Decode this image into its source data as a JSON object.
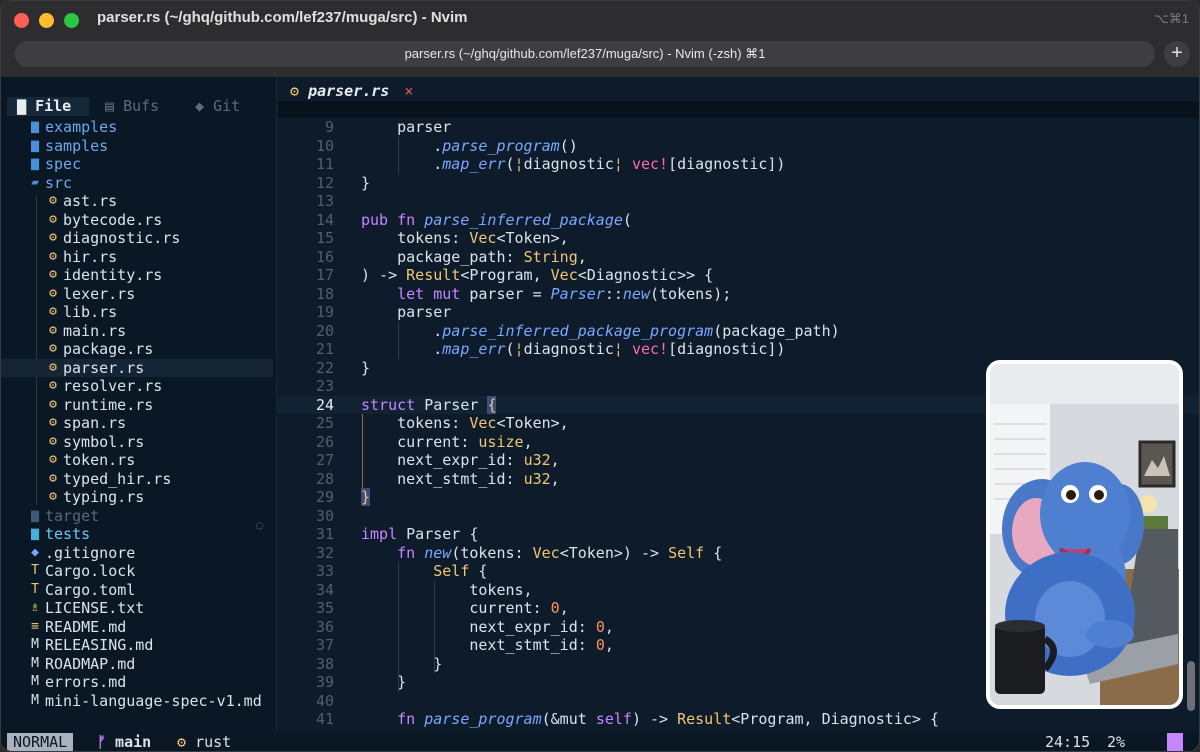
{
  "window": {
    "title": "parser.rs (~/ghq/github.com/lef237/muga/src) - Nvim",
    "shortcut": "⌥⌘1",
    "tab_title": "parser.rs (~/ghq/github.com/lef237/muga/src) - Nvim (-zsh) ⌘1",
    "new_tab_label": "+"
  },
  "sidebar": {
    "tabs": [
      {
        "icon": "▇",
        "label": "File"
      },
      {
        "icon": "▤",
        "label": "Bufs"
      },
      {
        "icon": "◆",
        "label": "Git"
      }
    ],
    "tree": [
      {
        "name": "examples",
        "icon": "▆",
        "kind": "folder",
        "icon_name": "folder-icon",
        "depth": 0
      },
      {
        "name": "samples",
        "icon": "▆",
        "kind": "folder",
        "icon_name": "folder-icon",
        "depth": 0
      },
      {
        "name": "spec",
        "icon": "▆",
        "kind": "folder",
        "icon_name": "folder-icon",
        "depth": 0
      },
      {
        "name": "src",
        "icon": "▰",
        "kind": "folder-open",
        "icon_name": "folder-open-icon",
        "depth": 0
      },
      {
        "name": "ast.rs",
        "icon": "⚙",
        "kind": "rust",
        "icon_name": "rust-file-icon",
        "depth": 1
      },
      {
        "name": "bytecode.rs",
        "icon": "⚙",
        "kind": "rust",
        "icon_name": "rust-file-icon",
        "depth": 1
      },
      {
        "name": "diagnostic.rs",
        "icon": "⚙",
        "kind": "rust",
        "icon_name": "rust-file-icon",
        "depth": 1
      },
      {
        "name": "hir.rs",
        "icon": "⚙",
        "kind": "rust",
        "icon_name": "rust-file-icon",
        "depth": 1
      },
      {
        "name": "identity.rs",
        "icon": "⚙",
        "kind": "rust",
        "icon_name": "rust-file-icon",
        "depth": 1
      },
      {
        "name": "lexer.rs",
        "icon": "⚙",
        "kind": "rust",
        "icon_name": "rust-file-icon",
        "depth": 1
      },
      {
        "name": "lib.rs",
        "icon": "⚙",
        "kind": "rust",
        "icon_name": "rust-file-icon",
        "depth": 1
      },
      {
        "name": "main.rs",
        "icon": "⚙",
        "kind": "rust",
        "icon_name": "rust-file-icon",
        "depth": 1
      },
      {
        "name": "package.rs",
        "icon": "⚙",
        "kind": "rust",
        "icon_name": "rust-file-icon",
        "depth": 1
      },
      {
        "name": "parser.rs",
        "icon": "⚙",
        "kind": "rust",
        "icon_name": "rust-file-icon",
        "depth": 1,
        "selected": true
      },
      {
        "name": "resolver.rs",
        "icon": "⚙",
        "kind": "rust",
        "icon_name": "rust-file-icon",
        "depth": 1
      },
      {
        "name": "runtime.rs",
        "icon": "⚙",
        "kind": "rust",
        "icon_name": "rust-file-icon",
        "depth": 1
      },
      {
        "name": "span.rs",
        "icon": "⚙",
        "kind": "rust",
        "icon_name": "rust-file-icon",
        "depth": 1
      },
      {
        "name": "symbol.rs",
        "icon": "⚙",
        "kind": "rust",
        "icon_name": "rust-file-icon",
        "depth": 1
      },
      {
        "name": "token.rs",
        "icon": "⚙",
        "kind": "rust",
        "icon_name": "rust-file-icon",
        "depth": 1
      },
      {
        "name": "typed_hir.rs",
        "icon": "⚙",
        "kind": "rust",
        "icon_name": "rust-file-icon",
        "depth": 1
      },
      {
        "name": "typing.rs",
        "icon": "⚙",
        "kind": "rust",
        "icon_name": "rust-file-icon",
        "depth": 1
      },
      {
        "name": "target",
        "icon": "▆",
        "kind": "folder-dim",
        "icon_name": "folder-icon",
        "depth": 0
      },
      {
        "name": "tests",
        "icon": "▆",
        "kind": "folder-test",
        "icon_name": "test-folder-icon",
        "depth": 0
      },
      {
        "name": ".gitignore",
        "icon": "◆",
        "kind": "git",
        "icon_name": "git-icon",
        "depth": 0
      },
      {
        "name": "Cargo.lock",
        "icon": "T",
        "kind": "toml",
        "icon_name": "toml-icon",
        "depth": 0
      },
      {
        "name": "Cargo.toml",
        "icon": "T",
        "kind": "toml",
        "icon_name": "toml-icon",
        "depth": 0
      },
      {
        "name": "LICENSE.txt",
        "icon": "♗",
        "kind": "license",
        "icon_name": "license-icon",
        "depth": 0
      },
      {
        "name": "README.md",
        "icon": "≡",
        "kind": "readme",
        "icon_name": "readme-icon",
        "depth": 0
      },
      {
        "name": "RELEASING.md",
        "icon": "M",
        "kind": "md",
        "icon_name": "markdown-icon",
        "depth": 0
      },
      {
        "name": "ROADMAP.md",
        "icon": "M",
        "kind": "md",
        "icon_name": "markdown-icon",
        "depth": 0
      },
      {
        "name": "errors.md",
        "icon": "M",
        "kind": "md",
        "icon_name": "markdown-icon",
        "depth": 0
      },
      {
        "name": "mini-language-spec-v1.md",
        "icon": "M",
        "kind": "md",
        "icon_name": "markdown-icon",
        "depth": 0
      }
    ],
    "spinner_icon": "◌"
  },
  "editor": {
    "tab": {
      "icon": "⚙",
      "filename": "parser.rs",
      "close": "×"
    },
    "current_line": 24,
    "lines": [
      {
        "n": "9",
        "t": [
          [
            "    parser",
            ""
          ]
        ]
      },
      {
        "n": "10",
        "t": [
          [
            "        .",
            ""
          ],
          [
            "parse_program",
            "fn"
          ],
          [
            "()",
            ""
          ]
        ]
      },
      {
        "n": "11",
        "t": [
          [
            "        .",
            ""
          ],
          [
            "map_err",
            "fn"
          ],
          [
            "(",
            ""
          ],
          [
            "¦",
            "pipe"
          ],
          [
            "diagnostic",
            ""
          ],
          [
            "¦",
            "pipe"
          ],
          [
            " ",
            ""
          ],
          [
            "vec!",
            "mac"
          ],
          [
            "[diagnostic])",
            ""
          ]
        ]
      },
      {
        "n": "12",
        "t": [
          [
            "}",
            ""
          ]
        ]
      },
      {
        "n": "13",
        "t": []
      },
      {
        "n": "14",
        "t": [
          [
            "pub fn ",
            "kw"
          ],
          [
            "parse_inferred_package",
            "fn"
          ],
          [
            "(",
            ""
          ]
        ]
      },
      {
        "n": "15",
        "t": [
          [
            "    tokens: ",
            ""
          ],
          [
            "Vec",
            "ty"
          ],
          [
            "<Token>,",
            ""
          ]
        ]
      },
      {
        "n": "16",
        "t": [
          [
            "    package_path: ",
            ""
          ],
          [
            "String",
            "ty"
          ],
          [
            ",",
            ""
          ]
        ]
      },
      {
        "n": "17",
        "t": [
          [
            ") -> ",
            ""
          ],
          [
            "Result",
            "ty"
          ],
          [
            "<Program, ",
            ""
          ],
          [
            "Vec",
            "ty"
          ],
          [
            "<Diagnostic>> {",
            ""
          ]
        ]
      },
      {
        "n": "18",
        "t": [
          [
            "    let mut ",
            "kw"
          ],
          [
            "parser = ",
            ""
          ],
          [
            "Parser",
            "fn"
          ],
          [
            "::",
            ""
          ],
          [
            "new",
            "fn"
          ],
          [
            "(tokens);",
            ""
          ]
        ]
      },
      {
        "n": "19",
        "t": [
          [
            "    parser",
            ""
          ]
        ]
      },
      {
        "n": "20",
        "t": [
          [
            "        .",
            ""
          ],
          [
            "parse_inferred_package_program",
            "fn"
          ],
          [
            "(package_path)",
            ""
          ]
        ]
      },
      {
        "n": "21",
        "t": [
          [
            "        .",
            ""
          ],
          [
            "map_err",
            "fn"
          ],
          [
            "(",
            ""
          ],
          [
            "¦",
            "pipe"
          ],
          [
            "diagnostic",
            ""
          ],
          [
            "¦",
            "pipe"
          ],
          [
            " ",
            ""
          ],
          [
            "vec!",
            "mac"
          ],
          [
            "[diagnostic])",
            ""
          ]
        ]
      },
      {
        "n": "22",
        "t": [
          [
            "}",
            ""
          ]
        ]
      },
      {
        "n": "23",
        "t": []
      },
      {
        "n": "24",
        "t": [
          [
            "struct ",
            "kw"
          ],
          [
            "Parser ",
            ""
          ],
          [
            "{",
            "brace"
          ]
        ]
      },
      {
        "n": "25",
        "t": [
          [
            "    tokens: ",
            ""
          ],
          [
            "Vec",
            "ty"
          ],
          [
            "<Token>,",
            ""
          ]
        ]
      },
      {
        "n": "26",
        "t": [
          [
            "    current: ",
            ""
          ],
          [
            "usize",
            "ty"
          ],
          [
            ",",
            ""
          ]
        ]
      },
      {
        "n": "27",
        "t": [
          [
            "    next_expr_id: ",
            ""
          ],
          [
            "u32",
            "ty"
          ],
          [
            ",",
            ""
          ]
        ]
      },
      {
        "n": "28",
        "t": [
          [
            "    next_stmt_id: ",
            ""
          ],
          [
            "u32",
            "ty"
          ],
          [
            ",",
            ""
          ]
        ]
      },
      {
        "n": "29",
        "t": [
          [
            "}",
            "brace"
          ]
        ]
      },
      {
        "n": "30",
        "t": []
      },
      {
        "n": "31",
        "t": [
          [
            "impl ",
            "kw"
          ],
          [
            "Parser {",
            ""
          ]
        ]
      },
      {
        "n": "32",
        "t": [
          [
            "    fn ",
            "kw"
          ],
          [
            "new",
            "fn"
          ],
          [
            "(tokens: ",
            ""
          ],
          [
            "Vec",
            "ty"
          ],
          [
            "<Token>) -> ",
            ""
          ],
          [
            "Self",
            "ty"
          ],
          [
            " {",
            ""
          ]
        ]
      },
      {
        "n": "33",
        "t": [
          [
            "        ",
            ""
          ],
          [
            "Self",
            "ty"
          ],
          [
            " {",
            ""
          ]
        ]
      },
      {
        "n": "34",
        "t": [
          [
            "            tokens,",
            ""
          ]
        ]
      },
      {
        "n": "35",
        "t": [
          [
            "            current: ",
            ""
          ],
          [
            "0",
            "num"
          ],
          [
            ",",
            ""
          ]
        ]
      },
      {
        "n": "36",
        "t": [
          [
            "            next_expr_id: ",
            ""
          ],
          [
            "0",
            "num"
          ],
          [
            ",",
            ""
          ]
        ]
      },
      {
        "n": "37",
        "t": [
          [
            "            next_stmt_id: ",
            ""
          ],
          [
            "0",
            "num"
          ],
          [
            ",",
            ""
          ]
        ]
      },
      {
        "n": "38",
        "t": [
          [
            "        }",
            ""
          ]
        ]
      },
      {
        "n": "39",
        "t": [
          [
            "    }",
            ""
          ]
        ]
      },
      {
        "n": "40",
        "t": []
      },
      {
        "n": "41",
        "t": [
          [
            "    fn ",
            "kw"
          ],
          [
            "parse_program",
            "fn"
          ],
          [
            "(&mut ",
            ""
          ],
          [
            "self",
            "kw"
          ],
          [
            ") -> ",
            ""
          ],
          [
            "Result",
            "ty"
          ],
          [
            "<Program, Diagnostic> {",
            ""
          ]
        ]
      }
    ]
  },
  "statusline": {
    "mode": "NORMAL",
    "branch_icon": "ᚠ",
    "branch": "main",
    "lang_icon": "⚙",
    "filetype": "rust",
    "position": "24:15",
    "percent": "2%"
  },
  "colors": {
    "background": "#0d1b2a",
    "folder": "#4a90d9",
    "rust": "#f0c674",
    "keyword": "#c586ff",
    "function": "#7aa7ff",
    "type": "#f0c674",
    "macro": "#ff6ab0",
    "number": "#ff8f5a"
  }
}
